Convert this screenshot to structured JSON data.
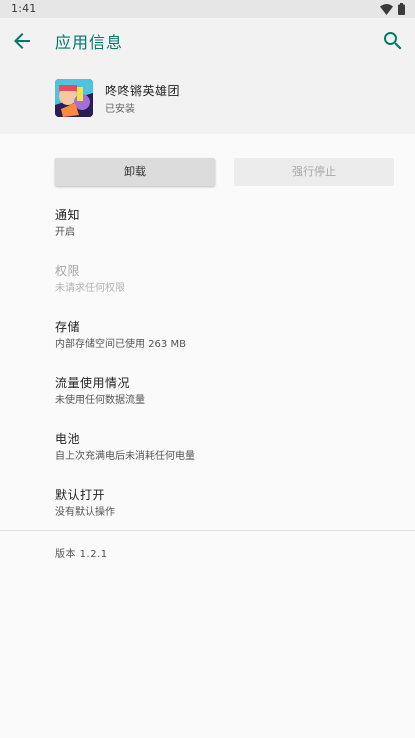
{
  "status_bar": {
    "time": "1:41",
    "icons": [
      "wifi-icon",
      "battery-icon"
    ]
  },
  "app_bar": {
    "title": "应用信息",
    "back_icon": "arrow-back-icon",
    "search_icon": "search-icon",
    "accent_color": "#00796b"
  },
  "app": {
    "name": "咚咚锵英雄团",
    "status": "已安装",
    "icon": "app-icon"
  },
  "buttons": {
    "uninstall": "卸载",
    "force_stop": "强行停止"
  },
  "settings": [
    {
      "title": "通知",
      "subtitle": "开启",
      "enabled": true
    },
    {
      "title": "权限",
      "subtitle": "未请求任何权限",
      "enabled": false
    },
    {
      "title": "存储",
      "subtitle": "内部存储空间已使用 263 MB",
      "enabled": true
    },
    {
      "title": "流量使用情况",
      "subtitle": "未使用任何数据流量",
      "enabled": true
    },
    {
      "title": "电池",
      "subtitle": "自上次充满电后未消耗任何电量",
      "enabled": true
    },
    {
      "title": "默认打开",
      "subtitle": "没有默认操作",
      "enabled": true
    }
  ],
  "version": "版本 1.2.1"
}
